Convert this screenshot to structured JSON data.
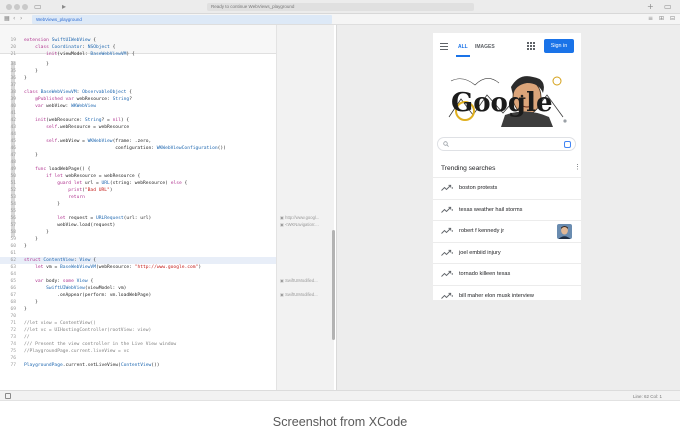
{
  "window": {
    "status_text": "Ready to continue WebViews_playground",
    "file_tab": "WebViews_playground",
    "bottom_position": "Line: 62  Col: 1"
  },
  "editor": {
    "lines": [
      {
        "n": "19",
        "code": "extension SwiftUIWebView {"
      },
      {
        "n": "20",
        "code": "    class Coordinator: NSObject {"
      },
      {
        "n": "21",
        "code": "        init(viewModel: BaseWebViewVM) {"
      },
      {
        "n": "34",
        "code": "        }"
      },
      {
        "n": "35",
        "code": "    }"
      },
      {
        "n": "36",
        "code": "}"
      },
      {
        "n": "37",
        "code": ""
      },
      {
        "n": "38",
        "code": "class BaseWebViewVM: ObservableObject {"
      },
      {
        "n": "39",
        "code": "    @Published var webResource: String?"
      },
      {
        "n": "40",
        "code": "    var webView: WKWebView"
      },
      {
        "n": "41",
        "code": ""
      },
      {
        "n": "42",
        "code": "    init(webResource: String? = nil) {"
      },
      {
        "n": "43",
        "code": "        self.webResource = webResource"
      },
      {
        "n": "44",
        "code": ""
      },
      {
        "n": "45",
        "code": "        self.webView = WKWebView(frame: .zero,"
      },
      {
        "n": "46",
        "code": "                                 configuration: WKWebViewConfiguration())"
      },
      {
        "n": "47",
        "code": "    }"
      },
      {
        "n": "48",
        "code": ""
      },
      {
        "n": "49",
        "code": "    func loadWebPage() {"
      },
      {
        "n": "50",
        "code": "        if let webResource = webResource {"
      },
      {
        "n": "51",
        "code": "            guard let url = URL(string: webResource) else {"
      },
      {
        "n": "52",
        "code": "                print(\"Bad URL\")"
      },
      {
        "n": "53",
        "code": "                return"
      },
      {
        "n": "54",
        "code": "            }"
      },
      {
        "n": "55",
        "code": ""
      },
      {
        "n": "56",
        "code": "            let request = URLRequest(url: url)"
      },
      {
        "n": "57",
        "code": "            webView.load(request)"
      },
      {
        "n": "58",
        "code": "        }"
      },
      {
        "n": "59",
        "code": "    }"
      },
      {
        "n": "60",
        "code": "}"
      },
      {
        "n": "61",
        "code": ""
      },
      {
        "n": "62",
        "code": "struct ContentView: View {"
      },
      {
        "n": "63",
        "code": "    let vm = BaseWebViewVM(webResource: \"http://www.google.com\")"
      },
      {
        "n": "64",
        "code": ""
      },
      {
        "n": "65",
        "code": "    var body: some View {"
      },
      {
        "n": "66",
        "code": "        SwiftUIWebView(viewModel: vm)"
      },
      {
        "n": "67",
        "code": "            .onAppear(perform: vm.loadWebPage)"
      },
      {
        "n": "68",
        "code": "    }"
      },
      {
        "n": "69",
        "code": "}"
      },
      {
        "n": "70",
        "code": ""
      },
      {
        "n": "71",
        "code": "//let view = ContentView()"
      },
      {
        "n": "72",
        "code": "//let vc = UIHostingController(rootView: view)"
      },
      {
        "n": "73",
        "code": "//"
      },
      {
        "n": "74",
        "code": "/// Present the view controller in the Live View window"
      },
      {
        "n": "75",
        "code": "//PlaygroundPage.current.liveView = vc"
      },
      {
        "n": "76",
        "code": ""
      },
      {
        "n": "77",
        "code": "PlaygroundPage.current.setLiveView(ContentView())"
      }
    ],
    "results": [
      {
        "text": "http://www.googl...",
        "row": 25
      },
      {
        "text": "<WKNavigation:...",
        "row": 26
      },
      {
        "text": "SwiftUIModified...",
        "row": 34
      },
      {
        "text": "SwiftUIModified...",
        "row": 36
      }
    ]
  },
  "preview": {
    "tabs": {
      "all": "ALL",
      "images": "IMAGES"
    },
    "signin": "Sign in",
    "doodle_text": "Google",
    "trending_title": "Trending searches",
    "trending": [
      {
        "label": "boston protests",
        "thumb": false
      },
      {
        "label": "texas weather hail storms",
        "thumb": false
      },
      {
        "label": "robert f kennedy jr",
        "thumb": true
      },
      {
        "label": "joel embiid injury",
        "thumb": false
      },
      {
        "label": "tornado killeen texas",
        "thumb": false
      },
      {
        "label": "bill maher elon musk interview",
        "thumb": false
      }
    ]
  },
  "caption": "Screenshot from XCode",
  "colors": {
    "keyword": "#b0338f",
    "type": "#1e67b0",
    "string": "#c41a16",
    "comment": "#808080",
    "accent": "#1a73e8"
  }
}
